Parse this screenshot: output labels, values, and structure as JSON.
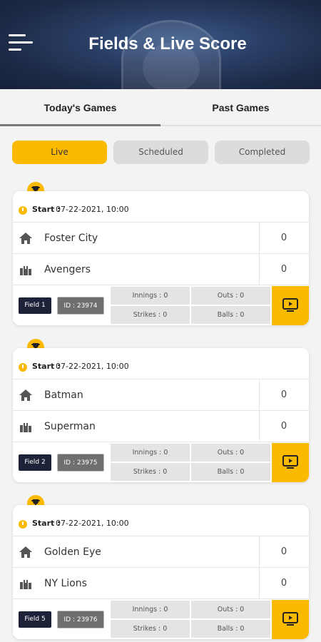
{
  "header": {
    "title": "Fields & Live Score",
    "menu_icon": "hamburger-menu-icon"
  },
  "tabs": [
    {
      "label": "Today's Games",
      "active": true
    },
    {
      "label": "Past Games",
      "active": false
    }
  ],
  "filters": [
    {
      "label": "Live",
      "active": true
    },
    {
      "label": "Scheduled",
      "active": false
    },
    {
      "label": "Completed",
      "active": false
    }
  ],
  "colors": {
    "accent": "#fbb900",
    "badge_dark": "#1d2238",
    "id_badge": "#6f6f6f",
    "pill_inactive": "#dcdcdc"
  },
  "games": [
    {
      "start_label": "Start :",
      "start_date": "07-22-2021, 10:00",
      "home_team": "Foster City",
      "home_score": "0",
      "away_team": "Avengers",
      "away_score": "0",
      "field": "Field 1",
      "id": "ID : 23974",
      "innings": "Innings : 0",
      "outs": "Outs : 0",
      "strikes": "Strikes : 0",
      "balls": "Balls : 0"
    },
    {
      "start_label": "Start :",
      "start_date": "07-22-2021, 10:00",
      "home_team": "Batman",
      "home_score": "0",
      "away_team": "Superman",
      "away_score": "0",
      "field": "Field 2",
      "id": "ID : 23975",
      "innings": "Innings : 0",
      "outs": "Outs : 0",
      "strikes": "Strikes : 0",
      "balls": "Balls : 0"
    },
    {
      "start_label": "Start :",
      "start_date": "07-22-2021, 10:00",
      "home_team": "Golden Eye",
      "home_score": "0",
      "away_team": "NY Lions",
      "away_score": "0",
      "field": "Field 5",
      "id": "ID : 23976",
      "innings": "Innings : 0",
      "outs": "Outs : 0",
      "strikes": "Strikes : 0",
      "balls": "Balls : 0"
    }
  ]
}
